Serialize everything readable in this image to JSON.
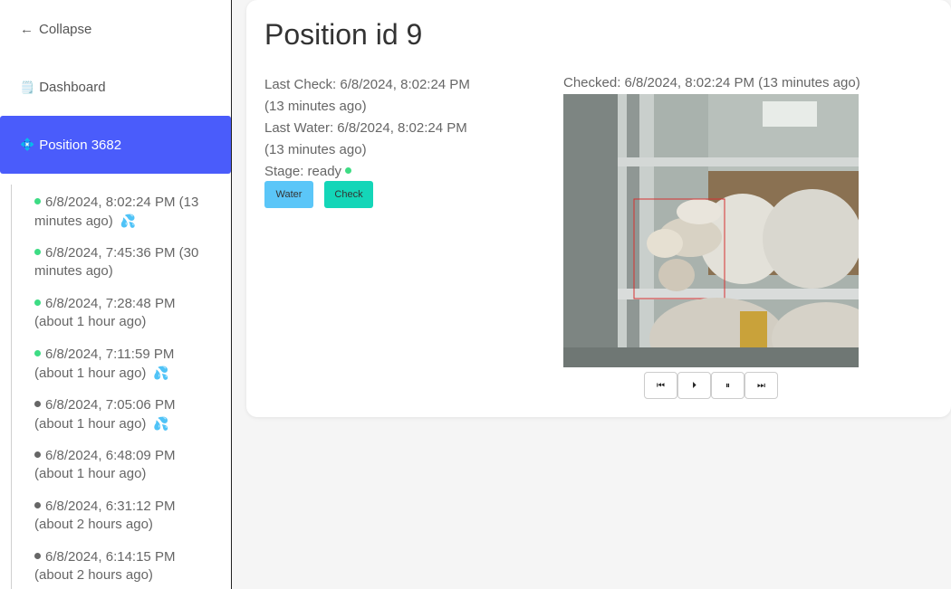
{
  "sidebar": {
    "collapse_label": "Collapse",
    "dashboard_label": "Dashboard",
    "active_label": "Position 3682",
    "history": [
      {
        "status": "green",
        "text": "6/8/2024, 8:02:24 PM (13 minutes ago)",
        "watered": true
      },
      {
        "status": "green",
        "text": "6/8/2024, 7:45:36 PM (30 minutes ago)",
        "watered": false
      },
      {
        "status": "green",
        "text": "6/8/2024, 7:28:48 PM (about 1 hour ago)",
        "watered": false
      },
      {
        "status": "green",
        "text": "6/8/2024, 7:11:59 PM (about 1 hour ago)",
        "watered": true
      },
      {
        "status": "gray",
        "text": "6/8/2024, 7:05:06 PM (about 1 hour ago)",
        "watered": true
      },
      {
        "status": "gray",
        "text": "6/8/2024, 6:48:09 PM (about 1 hour ago)",
        "watered": false
      },
      {
        "status": "gray",
        "text": "6/8/2024, 6:31:12 PM (about 2 hours ago)",
        "watered": false
      },
      {
        "status": "gray",
        "text": "6/8/2024, 6:14:15 PM (about 2 hours ago)",
        "watered": false
      }
    ]
  },
  "main": {
    "title": "Position id 9",
    "last_check": "Last Check: 6/8/2024, 8:02:24 PM (13 minutes ago)",
    "last_water": "Last Water: 6/8/2024, 8:02:24 PM (13 minutes ago)",
    "stage": "Stage: ready",
    "water_button": "Water",
    "check_button": "Check",
    "checked_label": "Checked: 6/8/2024, 8:02:24 PM (13 minutes ago)",
    "controls": {
      "first": "⏮",
      "play": "⏵",
      "pause": "⏸",
      "last": "⏭"
    }
  },
  "colors": {
    "active_nav": "#4a5cfb",
    "water_button": "#5bc6f8",
    "check_button": "#14d6b8",
    "status_green": "#3ddc84",
    "status_gray": "#666666"
  },
  "icons": {
    "collapse": "arrow-left-icon",
    "dashboard": "notepad-icon",
    "active": "diamond-icon",
    "watered": "water-drops-icon"
  }
}
